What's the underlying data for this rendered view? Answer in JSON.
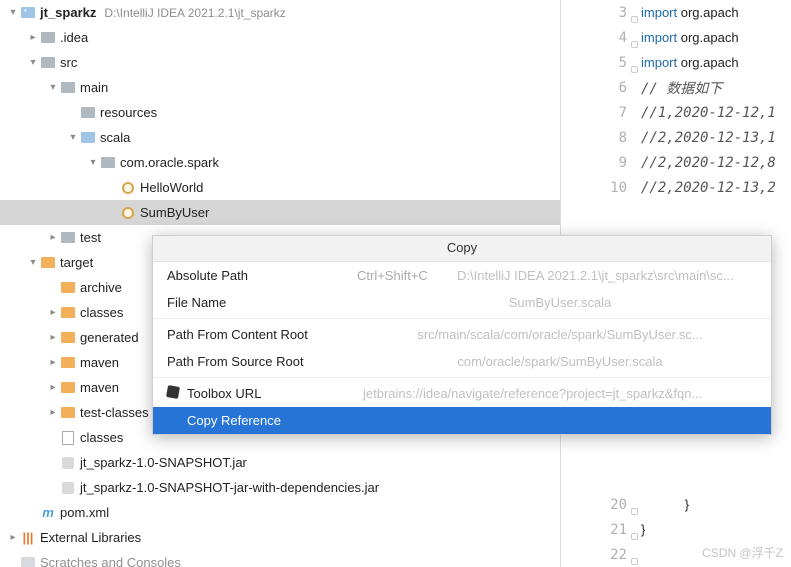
{
  "tree": {
    "root": {
      "name": "jt_sparkz",
      "path": "D:\\IntelliJ IDEA 2021.2.1\\jt_sparkz"
    },
    "nodes": {
      "idea": ".idea",
      "src": "src",
      "main": "main",
      "resources": "resources",
      "scala": "scala",
      "pkg": "com.oracle.spark",
      "hello": "HelloWorld",
      "sumby": "SumByUser",
      "test": "test",
      "target": "target",
      "archive": "archive",
      "classes": "classes",
      "gener": "generated",
      "maven1": "maven",
      "maven2": "maven",
      "testc": "test-classes",
      "classes2": "classes",
      "jar1": "jt_sparkz-1.0-SNAPSHOT.jar",
      "jar2": "jt_sparkz-1.0-SNAPSHOT-jar-with-dependencies.jar",
      "pom": "pom.xml",
      "ext": "External Libraries",
      "scratch": "Scratches and Consoles"
    }
  },
  "editor": {
    "lines": [
      {
        "n": 3,
        "kw": "import",
        "rest": " org.apach"
      },
      {
        "n": 4,
        "kw": "import",
        "rest": " org.apach"
      },
      {
        "n": 5,
        "kw": "import",
        "rest": " org.apach"
      },
      {
        "n": 6,
        "comment": "// 数据如下"
      },
      {
        "n": 7,
        "comment": "//1,2020-12-12,1"
      },
      {
        "n": 8,
        "comment": "//2,2020-12-13,1"
      },
      {
        "n": 9,
        "comment": "//2,2020-12-12,8"
      },
      {
        "n": 10,
        "comment": "//2,2020-12-13,2"
      }
    ],
    "tail": [
      {
        "n": 20,
        "brace": "}"
      },
      {
        "n": 21,
        "brace": "}"
      },
      {
        "n": 22,
        "brace": ""
      }
    ]
  },
  "popup": {
    "title": "Copy",
    "rows": {
      "abs": {
        "label": "Absolute Path",
        "shortcut": "Ctrl+Shift+C",
        "value": "D:\\IntelliJ IDEA 2021.2.1\\jt_sparkz\\src\\main\\sc..."
      },
      "fname": {
        "label": "File Name",
        "value": "SumByUser.scala"
      },
      "content": {
        "label": "Path From Content Root",
        "value": "src/main/scala/com/oracle/spark/SumByUser.sc..."
      },
      "source": {
        "label": "Path From Source Root",
        "value": "com/oracle/spark/SumByUser.scala"
      },
      "toolbox": {
        "label": "Toolbox URL",
        "value": "jetbrains://idea/navigate/reference?project=jt_sparkz&fqn..."
      },
      "ref": {
        "label": "Copy Reference"
      }
    }
  },
  "watermark": "CSDN @浮千Z"
}
